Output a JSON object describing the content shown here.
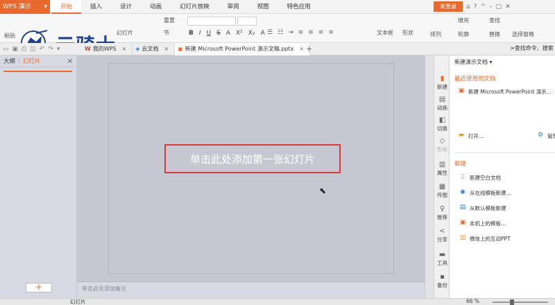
{
  "app": {
    "name": "WPS 演示",
    "caret": "▾"
  },
  "menu": {
    "items": [
      "开始",
      "插入",
      "设计",
      "动画",
      "幻灯片放映",
      "审阅",
      "视图",
      "特色应用"
    ]
  },
  "login_label": "未登录",
  "ribbon": {
    "paste": "粘贴",
    "new_slide": "幻灯片",
    "reset": "重置",
    "section": "节",
    "font_formats": [
      "B",
      "I",
      "U",
      "S",
      "A",
      "X²",
      "X₂",
      "A"
    ],
    "textbox": "文本框",
    "shape": "形状",
    "arrange": "排列",
    "fill": "填充",
    "outline": "轮廓",
    "find": "查找",
    "replace": "替换",
    "select_pane": "选择窗格"
  },
  "logo_text": "云骑士",
  "tabs": [
    {
      "label": "我的WPS",
      "close": "×"
    },
    {
      "label": "云文档",
      "close": "×"
    },
    {
      "label": "新建 Microsoft PowerPoint 演示文稿.pptx",
      "close": "×"
    }
  ],
  "add_tab": "+",
  "command_search": ">查找命令、搜索",
  "left_panel": {
    "tab_outline": "大纲",
    "tab_slides": "幻灯片",
    "close": "×",
    "add": "+"
  },
  "slide": {
    "title_placeholder": "单击此处添加第一张幻灯片"
  },
  "notes_placeholder": "单击此处添加备注",
  "right_strip": [
    "新建",
    "动画",
    "切换",
    "形状",
    "属性",
    "传图",
    "推荐",
    "分享",
    "工具",
    "备份"
  ],
  "pane": {
    "header": "新建演示文档",
    "recent_title": "最近使用的文档",
    "recent_item": "新建 Microsoft PowerPoint 演示...",
    "open": "打开...",
    "manage": "管理",
    "new_title": "新建",
    "new_items": [
      "新建空白文档",
      "从在线模板新建...",
      "从默认模板新建",
      "本机上的模板...",
      "微信上的互动PPT"
    ]
  },
  "status": {
    "mode": "幻灯片",
    "zoom": "66 %"
  }
}
